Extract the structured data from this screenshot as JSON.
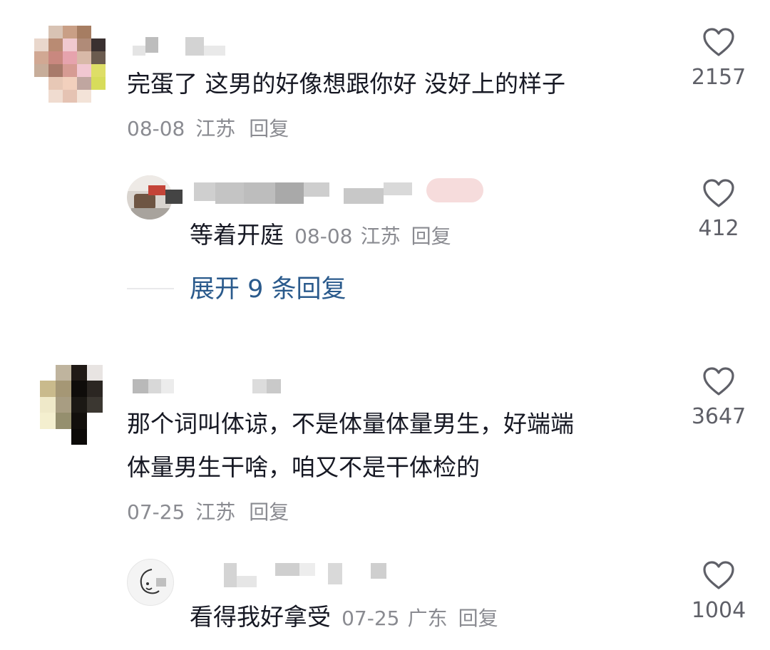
{
  "comments": [
    {
      "text": "完蛋了 这男的好像想跟你好 没好上的样子",
      "date": "08-08",
      "location": "江苏",
      "reply_label": "回复",
      "likes": "2157",
      "sub_reply": {
        "text": "等着开庭",
        "date": "08-08",
        "location": "江苏",
        "reply_label": "回复",
        "likes": "412"
      },
      "expand_label": "展开 9 条回复"
    },
    {
      "text_lines": [
        "那个词叫体谅，不是体量体量男生，好端端",
        "体量男生干啥，咱又不是干体检的"
      ],
      "date": "07-25",
      "location": "江苏",
      "reply_label": "回复",
      "likes": "3647",
      "sub_reply": {
        "text": "看得我好拿受",
        "date": "07-25",
        "location": "广东",
        "reply_label": "回复",
        "likes": "1004"
      }
    }
  ],
  "icons": {
    "like": "heart-outline-icon"
  },
  "colors": {
    "text": "#161823",
    "meta": "#8a8b91",
    "link": "#2a5a8c",
    "like_count": "#5f6068"
  }
}
